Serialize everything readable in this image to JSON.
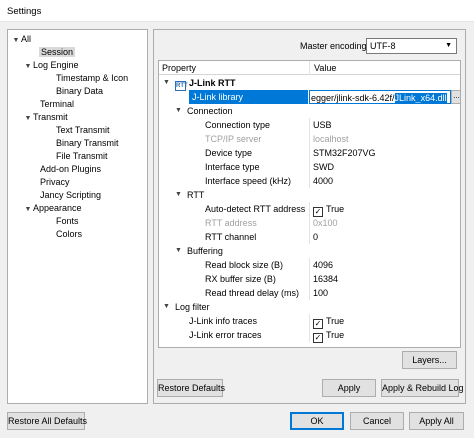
{
  "window": {
    "title": "Settings"
  },
  "tree": [
    {
      "label": "All",
      "expander": "▼"
    },
    {
      "label": "Session",
      "expander": "",
      "selected": true
    },
    {
      "label": "Log Engine",
      "expander": "▼"
    },
    {
      "label": "Timestamp & Icon",
      "expander": ""
    },
    {
      "label": "Binary Data",
      "expander": ""
    },
    {
      "label": "Terminal",
      "expander": ""
    },
    {
      "label": "Transmit",
      "expander": "▼"
    },
    {
      "label": "Text Transmit",
      "expander": ""
    },
    {
      "label": "Binary Transmit",
      "expander": ""
    },
    {
      "label": "File Transmit",
      "expander": ""
    },
    {
      "label": "Add-on Plugins",
      "expander": ""
    },
    {
      "label": "Privacy",
      "expander": ""
    },
    {
      "label": "Jancy Scripting",
      "expander": ""
    },
    {
      "label": "Appearance",
      "expander": "▼"
    },
    {
      "label": "Fonts",
      "expander": ""
    },
    {
      "label": "Colors",
      "expander": ""
    }
  ],
  "encoding": {
    "label": "Master encoding:",
    "value": "UTF-8"
  },
  "grid": {
    "col_property": "Property",
    "col_value": "Value",
    "rtt_icon": "RTT",
    "rows": [
      {
        "name": "J-Link RTT",
        "value": ""
      },
      {
        "name": "J-Link library",
        "value_plain": "egger/jlink-sdk-6.42f/",
        "value_sel": "JLink_x64.dll",
        "button": "..."
      },
      {
        "name": "Connection",
        "value": ""
      },
      {
        "name": "Connection type",
        "value": "USB"
      },
      {
        "name": "TCP/IP server",
        "value": "localhost"
      },
      {
        "name": "Device type",
        "value": "STM32F207VG"
      },
      {
        "name": "Interface type",
        "value": "SWD"
      },
      {
        "name": "Interface speed (kHz)",
        "value": "4000"
      },
      {
        "name": "RTT",
        "value": ""
      },
      {
        "name": "Auto-detect RTT address",
        "value": "True"
      },
      {
        "name": "RTT address",
        "value": "0x100"
      },
      {
        "name": "RTT channel",
        "value": "0"
      },
      {
        "name": "Buffering",
        "value": ""
      },
      {
        "name": "Read block size (B)",
        "value": "4096"
      },
      {
        "name": "RX buffer size (B)",
        "value": "16384"
      },
      {
        "name": "Read thread delay (ms)",
        "value": "100"
      },
      {
        "name": "Log filter",
        "value": ""
      },
      {
        "name": "J-Link info traces",
        "value": "True"
      },
      {
        "name": "J-Link error traces",
        "value": "True"
      }
    ]
  },
  "buttons": {
    "layers": "Layers...",
    "restore_defaults": "Restore Defaults",
    "apply_panel": "Apply",
    "apply_rebuild": "Apply & Rebuild Log",
    "restore_all": "Restore All Defaults",
    "ok": "OK",
    "cancel": "Cancel",
    "apply_all": "Apply All"
  },
  "icons": {
    "expand": "chevron-down-icon",
    "checked": "check-icon"
  },
  "colors": {
    "selection": "#0078d7",
    "tree_selection": "#d9d9d9"
  }
}
